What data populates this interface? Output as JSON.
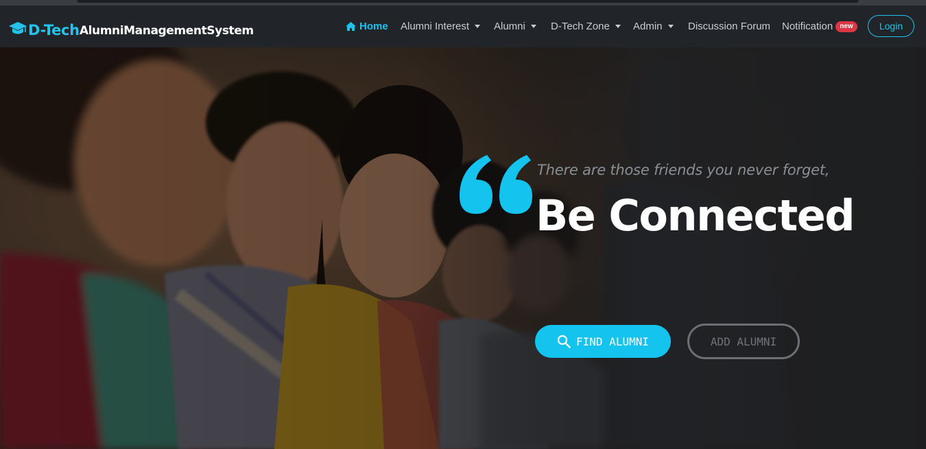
{
  "brand": {
    "name_part1": "D-Tech",
    "name_part2": "AlumniManagementSystem",
    "icon": "graduation-cap-icon"
  },
  "nav": {
    "home": "Home",
    "alumni_interest": "Alumni Interest",
    "alumni": "Alumni",
    "dtech_zone": "D-Tech Zone",
    "admin": "Admin",
    "discussion_forum": "Discussion Forum",
    "notification": "Notification",
    "notification_badge": "new",
    "login": "Login"
  },
  "hero": {
    "tagline": "There are those friends you never forget,",
    "headline": "Be Connected",
    "find_button": "FIND ALUMNI",
    "add_button": "ADD ALUMNI"
  },
  "colors": {
    "accent": "#1ec4ef",
    "badge": "#dc3545",
    "navbar_bg": "#212529"
  }
}
